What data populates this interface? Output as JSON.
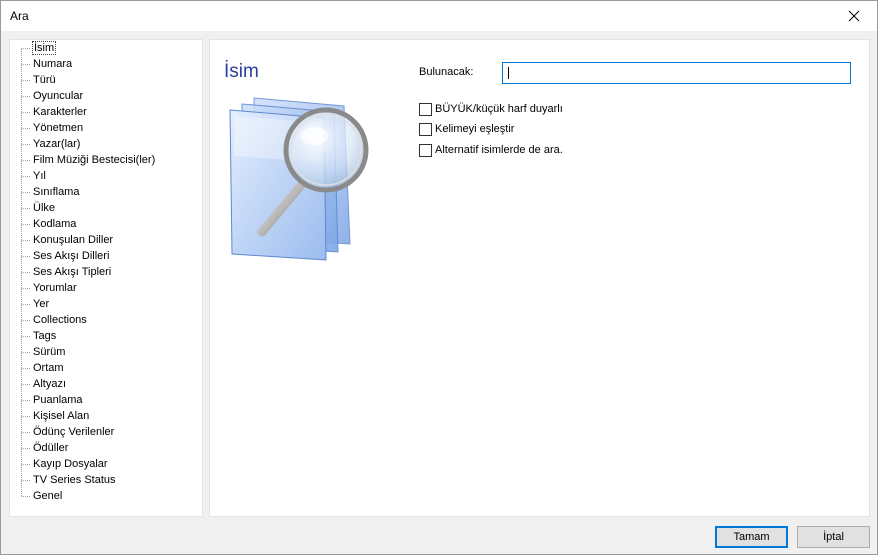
{
  "window": {
    "title": "Ara"
  },
  "tree": {
    "items": [
      {
        "label": "İsim",
        "selected": true
      },
      {
        "label": "Numara"
      },
      {
        "label": "Türü"
      },
      {
        "label": "Oyuncular"
      },
      {
        "label": "Karakterler"
      },
      {
        "label": "Yönetmen"
      },
      {
        "label": "Yazar(lar)"
      },
      {
        "label": "Film Müziği Bestecisi(ler)"
      },
      {
        "label": "Yıl"
      },
      {
        "label": "Sınıflama"
      },
      {
        "label": "Ülke"
      },
      {
        "label": "Kodlama"
      },
      {
        "label": "Konuşulan Diller"
      },
      {
        "label": "Ses Akışı Dilleri"
      },
      {
        "label": "Ses Akışı Tipleri"
      },
      {
        "label": "Yorumlar"
      },
      {
        "label": "Yer"
      },
      {
        "label": "Collections"
      },
      {
        "label": "Tags"
      },
      {
        "label": "Sürüm"
      },
      {
        "label": "Ortam"
      },
      {
        "label": "Altyazı"
      },
      {
        "label": "Puanlama"
      },
      {
        "label": "Kişisel Alan"
      },
      {
        "label": "Ödünç Verilenler"
      },
      {
        "label": "Ödüller"
      },
      {
        "label": "Kayıp Dosyalar"
      },
      {
        "label": "TV Series Status"
      },
      {
        "label": "Genel"
      }
    ]
  },
  "content": {
    "title": "İsim",
    "image_icon": "magnifier-documents-icon",
    "find_label": "Bulunacak:",
    "find_value": "",
    "options": [
      {
        "label": "BÜYÜK/küçük harf duyarlı",
        "checked": false
      },
      {
        "label": "Kelimeyi eşleştir",
        "checked": false
      },
      {
        "label": "Alternatif isimlerde de ara.",
        "checked": false
      }
    ]
  },
  "buttons": {
    "ok": "Tamam",
    "cancel": "İptal"
  },
  "colors": {
    "title_accent": "#2b3f9a",
    "focus_border": "#0078d7"
  }
}
